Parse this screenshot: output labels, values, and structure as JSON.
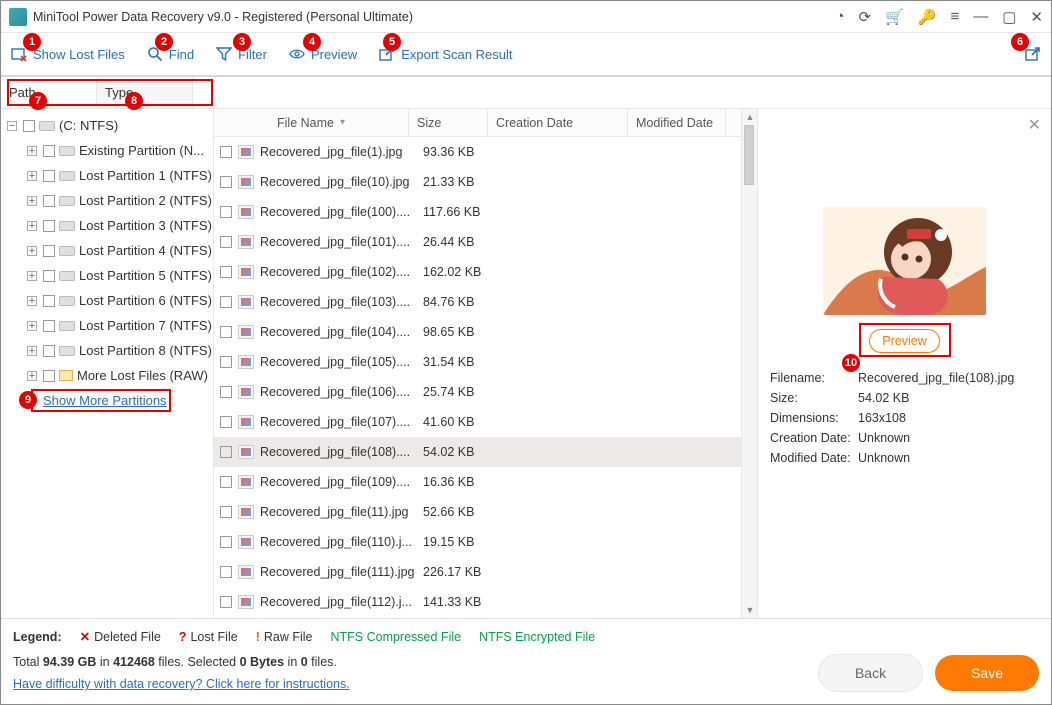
{
  "app": {
    "title": "MiniTool Power Data Recovery v9.0 - Registered (Personal Ultimate)"
  },
  "toolbar": {
    "show_lost": "Show Lost Files",
    "find": "Find",
    "filter": "Filter",
    "preview": "Preview",
    "export": "Export Scan Result"
  },
  "tabs": {
    "path": "Path",
    "type": "Type"
  },
  "tree": {
    "root": "(C: NTFS)",
    "items": [
      "Existing Partition (N...",
      "Lost Partition 1 (NTFS)",
      "Lost Partition 2 (NTFS)",
      "Lost Partition 3 (NTFS)",
      "Lost Partition 4 (NTFS)",
      "Lost Partition 5 (NTFS)",
      "Lost Partition 6 (NTFS)",
      "Lost Partition 7 (NTFS)",
      "Lost Partition 8 (NTFS)",
      "More Lost Files (RAW)"
    ],
    "show_more": "Show More Partitions"
  },
  "columns": {
    "name": "File Name",
    "size": "Size",
    "cd": "Creation Date",
    "md": "Modified Date"
  },
  "files": [
    {
      "name": "Recovered_jpg_file(1).jpg",
      "size": "93.36 KB"
    },
    {
      "name": "Recovered_jpg_file(10).jpg",
      "size": "21.33 KB"
    },
    {
      "name": "Recovered_jpg_file(100)....",
      "size": "117.66 KB"
    },
    {
      "name": "Recovered_jpg_file(101)....",
      "size": "26.44 KB"
    },
    {
      "name": "Recovered_jpg_file(102)....",
      "size": "162.02 KB"
    },
    {
      "name": "Recovered_jpg_file(103)....",
      "size": "84.76 KB"
    },
    {
      "name": "Recovered_jpg_file(104)....",
      "size": "98.65 KB"
    },
    {
      "name": "Recovered_jpg_file(105)....",
      "size": "31.54 KB"
    },
    {
      "name": "Recovered_jpg_file(106)....",
      "size": "25.74 KB"
    },
    {
      "name": "Recovered_jpg_file(107)....",
      "size": "41.60 KB"
    },
    {
      "name": "Recovered_jpg_file(108)....",
      "size": "54.02 KB",
      "selected": true
    },
    {
      "name": "Recovered_jpg_file(109)....",
      "size": "16.36 KB"
    },
    {
      "name": "Recovered_jpg_file(11).jpg",
      "size": "52.66 KB"
    },
    {
      "name": "Recovered_jpg_file(110).j...",
      "size": "19.15 KB"
    },
    {
      "name": "Recovered_jpg_file(111).jpg",
      "size": "226.17 KB"
    },
    {
      "name": "Recovered_jpg_file(112).j...",
      "size": "141.33 KB"
    }
  ],
  "preview": {
    "btn": "Preview",
    "filename_label": "Filename:",
    "filename": "Recovered_jpg_file(108).jpg",
    "size_label": "Size:",
    "size": "54.02 KB",
    "dim_label": "Dimensions:",
    "dim": "163x108",
    "cd_label": "Creation Date:",
    "cd": "Unknown",
    "md_label": "Modified Date:",
    "md": "Unknown"
  },
  "legend": {
    "title": "Legend:",
    "deleted": "Deleted File",
    "lost": "Lost File",
    "raw": "Raw File",
    "compressed": "NTFS Compressed File",
    "encrypted": "NTFS Encrypted File"
  },
  "totals": {
    "text1": "Total ",
    "size": "94.39 GB",
    "text2": " in ",
    "files": "412468",
    "text3": " files.  Selected ",
    "sel_size": "0 Bytes",
    "text4": " in ",
    "sel_files": "0",
    "text5": " files."
  },
  "help_link": "Have difficulty with data recovery? Click here for instructions.",
  "buttons": {
    "back": "Back",
    "save": "Save"
  },
  "badges": {
    "b1": "1",
    "b2": "2",
    "b3": "3",
    "b4": "4",
    "b5": "5",
    "b6": "6",
    "b7": "7",
    "b8": "8",
    "b9": "9",
    "b10": "10"
  }
}
